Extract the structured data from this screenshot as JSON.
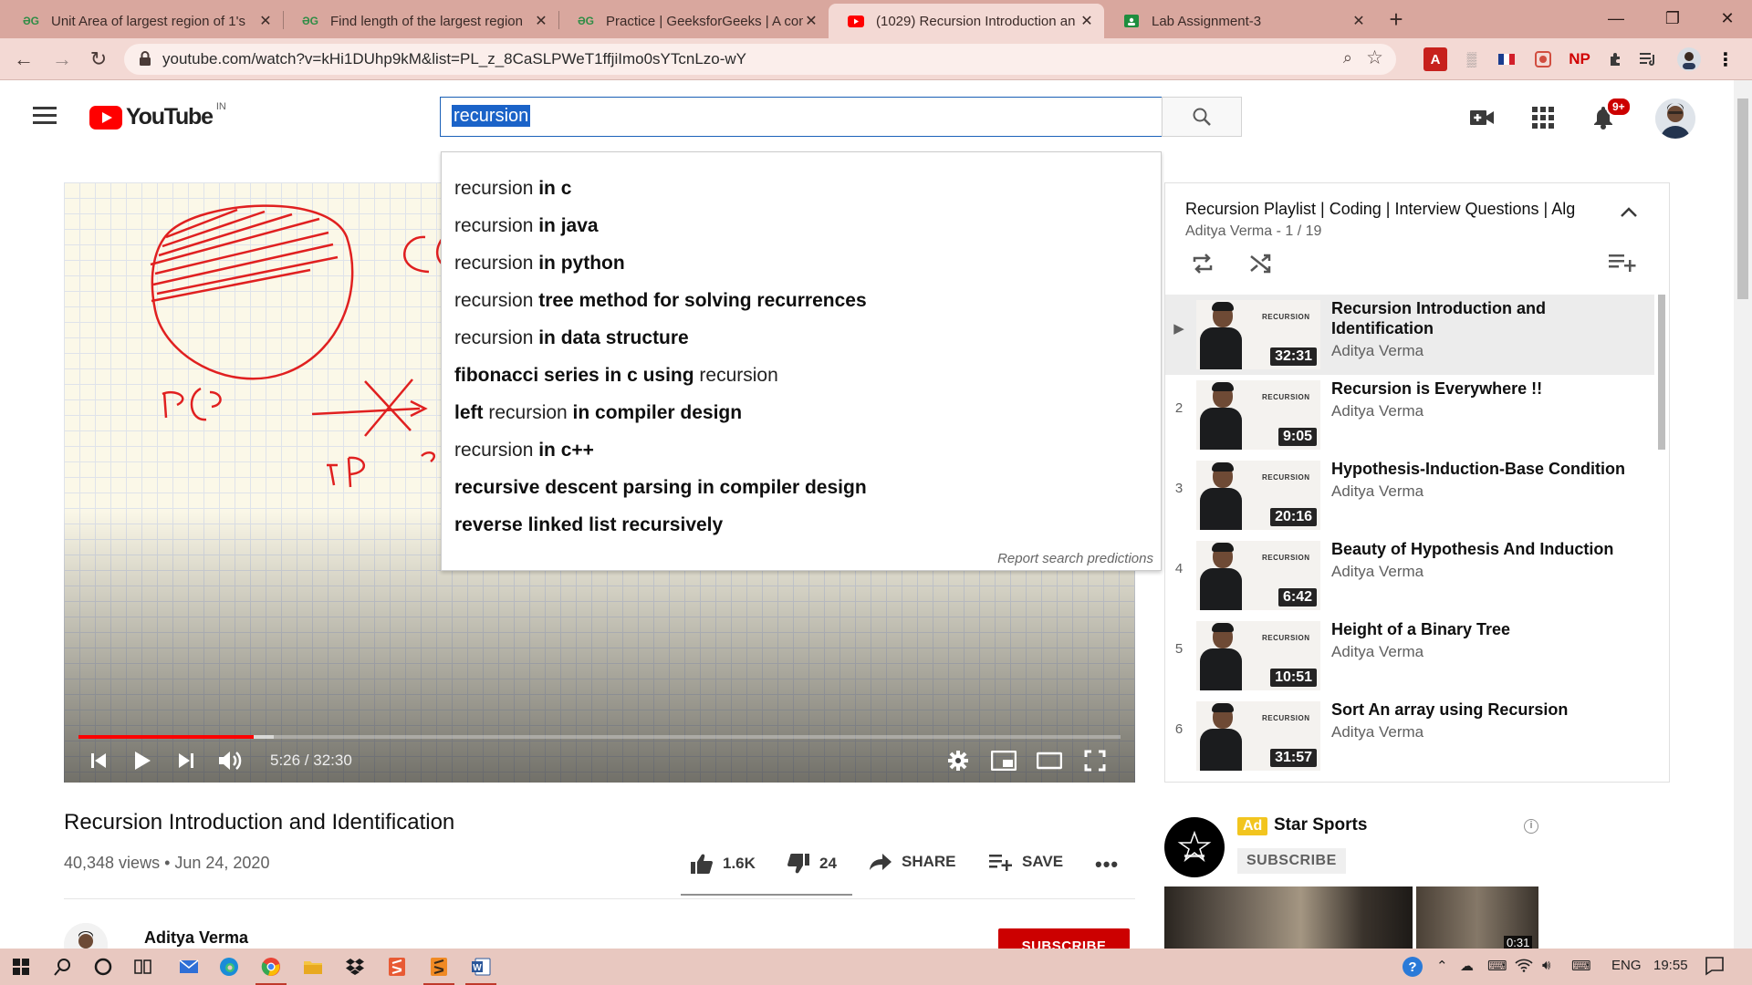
{
  "browser": {
    "tabs": [
      {
        "label": "Unit Area of largest region of 1's",
        "favicon": "gfg-icon",
        "active": false
      },
      {
        "label": "Find length of the largest region",
        "favicon": "gfg-icon",
        "active": false
      },
      {
        "label": "Practice | GeeksforGeeks | A comp",
        "favicon": "gfg-icon",
        "active": false
      },
      {
        "label": "(1029) Recursion Introduction an",
        "favicon": "youtube-icon",
        "active": true
      },
      {
        "label": "Lab Assignment-3",
        "favicon": "classroom-icon",
        "active": false
      }
    ],
    "url": "youtube.com/watch?v=kHi1DUhp9kM&list=PL_z_8CaSLPWeT1ffjiImo0sYTcnLzo-wY",
    "extensions": [
      "acrobat-icon",
      "translate-icon",
      "flag-icon",
      "record-icon",
      "NP",
      "puzzle-icon",
      "media-icon"
    ]
  },
  "youtube": {
    "logo_text": "YouTube",
    "region": "IN",
    "search_query": "recursion",
    "notifications_badge": "9+"
  },
  "suggestions": [
    [
      {
        "t": "recursion ",
        "b": false
      },
      {
        "t": "in c",
        "b": true
      }
    ],
    [
      {
        "t": "recursion ",
        "b": false
      },
      {
        "t": "in java",
        "b": true
      }
    ],
    [
      {
        "t": "recursion ",
        "b": false
      },
      {
        "t": "in python",
        "b": true
      }
    ],
    [
      {
        "t": "recursion ",
        "b": false
      },
      {
        "t": "tree method for solving recurrences",
        "b": true
      }
    ],
    [
      {
        "t": "recursion ",
        "b": false
      },
      {
        "t": "in data structure",
        "b": true
      }
    ],
    [
      {
        "t": "fibonacci series in c using ",
        "b": true
      },
      {
        "t": "recursion",
        "b": false
      }
    ],
    [
      {
        "t": "left ",
        "b": true
      },
      {
        "t": "recursion ",
        "b": false
      },
      {
        "t": "in compiler design",
        "b": true
      }
    ],
    [
      {
        "t": "recursion ",
        "b": false
      },
      {
        "t": "in c++",
        "b": true
      }
    ],
    [
      {
        "t": "recursive descent parsing in compiler design",
        "b": true
      }
    ],
    [
      {
        "t": "reverse linked list recursively",
        "b": true
      }
    ]
  ],
  "report_predictions": "Report search predictions",
  "player": {
    "time": "5:26 / 32:30",
    "played_fraction": 0.168,
    "buffered_fraction": 0.187
  },
  "video": {
    "title": "Recursion Introduction and Identification",
    "meta": "40,348 views • Jun 24, 2020",
    "likes": "1.6K",
    "dislikes": "24",
    "share": "SHARE",
    "save": "SAVE",
    "channel": "Aditya Verma",
    "subscribe": "SUBSCRIBE"
  },
  "playlist": {
    "title": "Recursion Playlist | Coding | Interview Questions | Alg",
    "subtitle": "Aditya Verma - 1 / 19",
    "items": [
      {
        "index": "▶",
        "title": "Recursion Introduction and Identification",
        "channel": "Aditya Verma",
        "duration": "32:31",
        "active": true
      },
      {
        "index": "2",
        "title": "Recursion is Everywhere !!",
        "channel": "Aditya Verma",
        "duration": "9:05",
        "active": false
      },
      {
        "index": "3",
        "title": "Hypothesis-Induction-Base Condition",
        "channel": "Aditya Verma",
        "duration": "20:16",
        "active": false
      },
      {
        "index": "4",
        "title": "Beauty of Hypothesis And Induction",
        "channel": "Aditya Verma",
        "duration": "6:42",
        "active": false
      },
      {
        "index": "5",
        "title": "Height of a Binary Tree",
        "channel": "Aditya Verma",
        "duration": "10:51",
        "active": false
      },
      {
        "index": "6",
        "title": "Sort An array using Recursion",
        "channel": "Aditya Verma",
        "duration": "31:57",
        "active": false
      }
    ],
    "thumb_label": "RECURSION"
  },
  "ad": {
    "badge": "Ad",
    "name": "Star Sports",
    "subscribe": "SUBSCRIBE",
    "duration": "0:31"
  },
  "taskbar": {
    "lang": "ENG",
    "clock": "19:55"
  },
  "colors": {
    "youtube_red": "#ff0000",
    "tabstrip": "#d9a79e",
    "toolbar": "#f3d9d4",
    "highlight": "#1b63c8"
  }
}
